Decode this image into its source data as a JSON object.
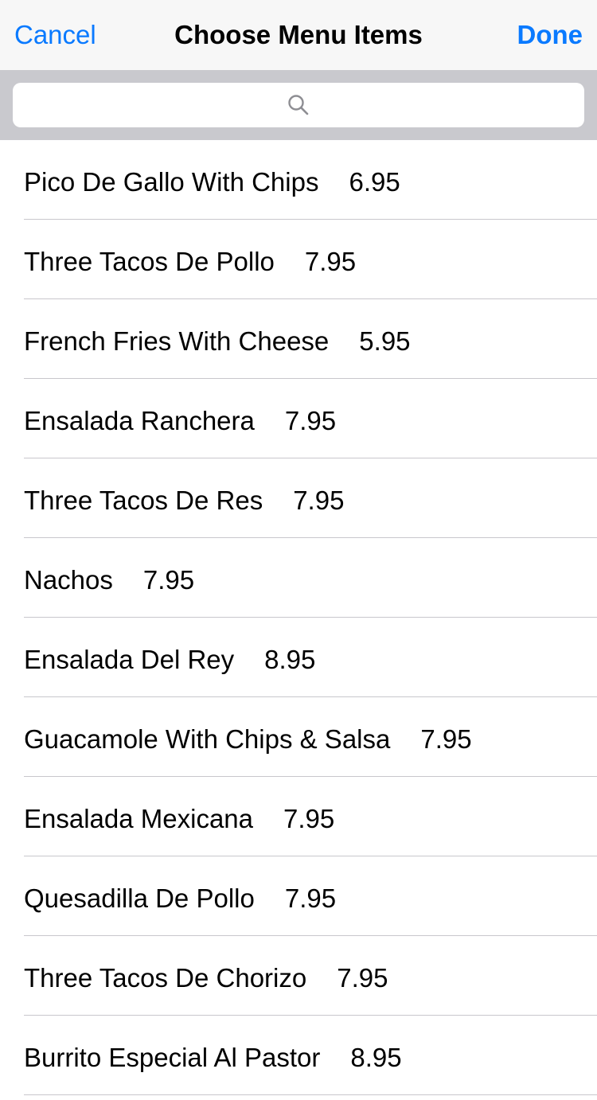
{
  "navbar": {
    "cancel_label": "Cancel",
    "title": "Choose Menu Items",
    "done_label": "Done"
  },
  "search": {
    "icon": "search-icon",
    "placeholder": ""
  },
  "colors": {
    "accent": "#0a7aff",
    "navbar_bg": "#f7f7f7",
    "search_bar_bg": "#c9c9ce",
    "separator": "#c8c7cc"
  },
  "menu_items": [
    {
      "name": "Pico De Gallo With Chips",
      "price": "6.95"
    },
    {
      "name": "Three Tacos De Pollo",
      "price": "7.95"
    },
    {
      "name": "French Fries With Cheese",
      "price": "5.95"
    },
    {
      "name": "Ensalada Ranchera",
      "price": "7.95"
    },
    {
      "name": "Three Tacos De Res",
      "price": "7.95"
    },
    {
      "name": "Nachos",
      "price": "7.95"
    },
    {
      "name": "Ensalada Del Rey",
      "price": "8.95"
    },
    {
      "name": "Guacamole With Chips & Salsa",
      "price": "7.95"
    },
    {
      "name": "Ensalada Mexicana",
      "price": "7.95"
    },
    {
      "name": "Quesadilla De Pollo",
      "price": "7.95"
    },
    {
      "name": "Three Tacos De Chorizo",
      "price": "7.95"
    },
    {
      "name": "Burrito Especial Al Pastor",
      "price": "8.95"
    }
  ]
}
